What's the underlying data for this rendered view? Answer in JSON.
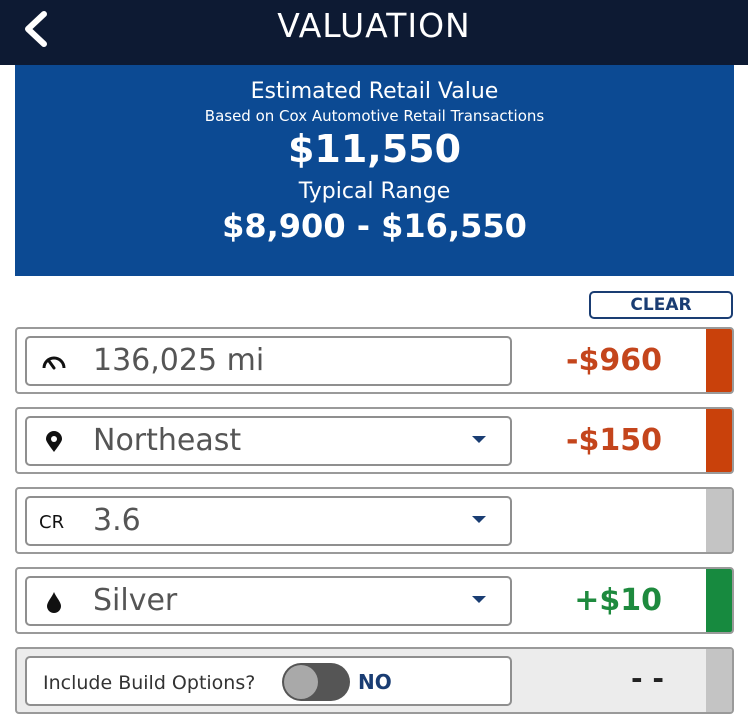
{
  "header": {
    "title": "VALUATION",
    "back_icon": "chevron-left-icon"
  },
  "valuation": {
    "heading": "Estimated Retail Value",
    "subheading": "Based on Cox Automotive Retail Transactions",
    "value": "$11,550",
    "range_label": "Typical Range",
    "range": "$8,900 - $16,550"
  },
  "clear_label": "CLEAR",
  "adjustments": [
    {
      "id": "mileage",
      "icon": "speedometer-icon",
      "value": "136,025 mi",
      "adjustment": "-$960",
      "color": "#c9410b",
      "dropdown": false
    },
    {
      "id": "region",
      "icon": "location-pin-icon",
      "value": "Northeast",
      "adjustment": "-$150",
      "color": "#c9410b",
      "dropdown": true
    },
    {
      "id": "condition",
      "icon_text": "CR",
      "value": "3.6",
      "adjustment": "",
      "color": "#c4c4c4",
      "dropdown": true
    },
    {
      "id": "color",
      "icon": "paint-drop-icon",
      "value": "Silver",
      "adjustment": "+$10",
      "color": "#178a3f",
      "dropdown": true
    }
  ],
  "build_options": {
    "label": "Include Build Options?",
    "state": "NO",
    "enabled": false,
    "adjustment": "- -",
    "color": "#c4c4c4"
  },
  "colors": {
    "header_bg": "#0d1a33",
    "panel_bg": "#0c4a93",
    "accent": "#1a3d73",
    "negative": "#c4451c",
    "positive": "#1e8a3e"
  }
}
